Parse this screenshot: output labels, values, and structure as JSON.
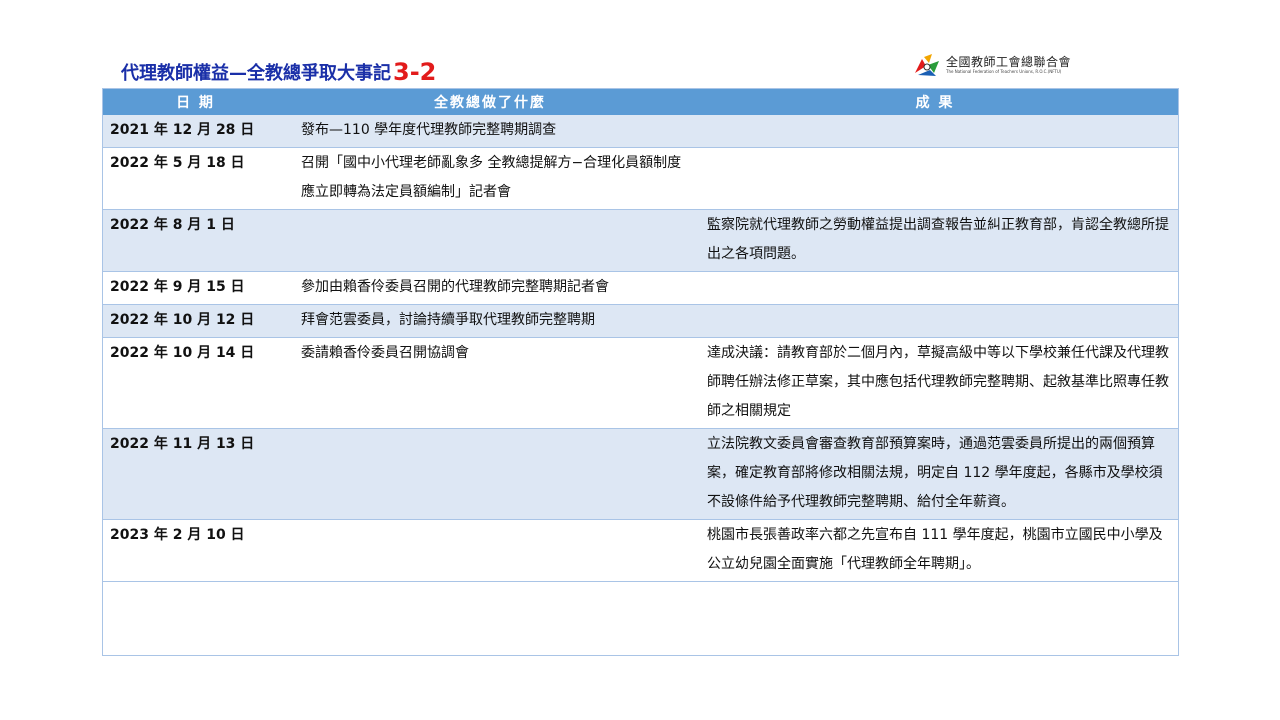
{
  "header": {
    "title": "代理教師權益—全教總爭取大事記",
    "title_suffix": "3-2",
    "logo_cn": "全國教師工會總聯合會",
    "logo_en": "The National Federation of Teachers Unions, R.O.C.(NFTU)"
  },
  "table": {
    "columns": [
      "日 期",
      "全教總做了什麼",
      "成 果"
    ],
    "rows": [
      {
        "date": "2021 年 12 月 28 日",
        "action": "發布—110 學年度代理教師完整聘期調查",
        "result": ""
      },
      {
        "date": "2022 年 5 月 18 日",
        "action": "召開「國中小代理老師亂象多 全教總提解方−合理化員額制度應立即轉為法定員額編制」記者會",
        "result": ""
      },
      {
        "date": "2022 年 8 月 1 日",
        "action": "",
        "result": "監察院就代理教師之勞動權益提出調查報告並糾正教育部，肯認全教總所提出之各項問題。"
      },
      {
        "date": "2022 年 9 月 15 日",
        "action": "參加由賴香伶委員召開的代理教師完整聘期記者會",
        "result": ""
      },
      {
        "date": "2022 年 10 月 12 日",
        "action": "拜會范雲委員，討論持續爭取代理教師完整聘期",
        "result": ""
      },
      {
        "date": "2022 年 10 月 14 日",
        "action": "委請賴香伶委員召開協調會",
        "result": "達成決議：請教育部於二個月內，草擬高級中等以下學校兼任代課及代理教師聘任辦法修正草案，其中應包括代理教師完整聘期、起敘基準比照專任教師之相關規定"
      },
      {
        "date": "2022 年 11 月 13 日",
        "action": "",
        "result": "立法院教文委員會審查教育部預算案時，通過范雲委員所提出的兩個預算案，確定教育部將修改相關法規，明定自 112 學年度起，各縣市及學校須不設條件給予代理教師完整聘期、給付全年薪資。"
      },
      {
        "date": "2023 年 2 月 10 日",
        "action": "",
        "result": "桃園市長張善政率六都之先宣布自 111 學年度起，桃園市立國民中小學及公立幼兒園全面實施「代理教師全年聘期」。"
      }
    ]
  },
  "colors": {
    "header_bg": "#5b9bd5",
    "row_alt": "#dde7f4",
    "title": "#1a2fa8",
    "accent": "#e21b1b"
  },
  "icons": {
    "logo": "nftu-logo-icon"
  }
}
